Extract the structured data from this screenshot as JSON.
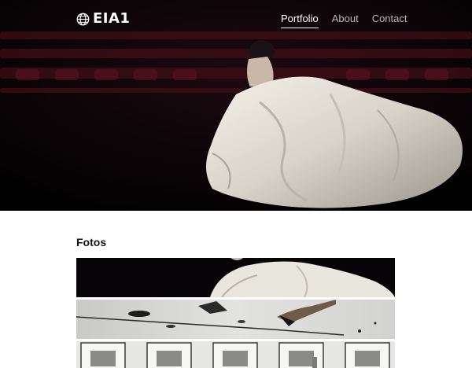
{
  "brand": {
    "name": "EIA1",
    "icon": "globe-icon"
  },
  "nav": {
    "items": [
      {
        "label": "Portfolio",
        "active": true
      },
      {
        "label": "About",
        "active": false
      },
      {
        "label": "Contact",
        "active": false
      }
    ]
  },
  "hero": {
    "image": "dancer-in-white-fabric-theater"
  },
  "section": {
    "title": "Fotos"
  },
  "gallery": {
    "items": [
      {
        "image": "dancer-white-fabric"
      },
      {
        "image": "charcoal-drawing-hand"
      },
      {
        "image": "framed-prints-gallery"
      }
    ]
  },
  "colors": {
    "nav_text": "#b8b8b8",
    "nav_active": "#ffffff",
    "heading": "#111111"
  }
}
